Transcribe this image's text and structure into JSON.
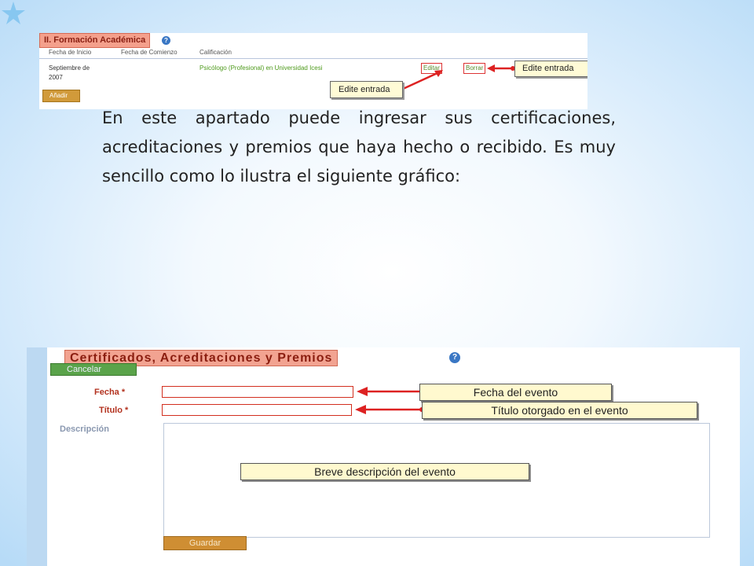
{
  "top_screenshot": {
    "section_title": "II. Formación Académica",
    "help_icon": "question-icon",
    "columns": [
      "Fecha de Inicio",
      "Fecha de Comienzo",
      "Calificación"
    ],
    "row": {
      "date_line1": "Septiembre de",
      "date_line2": "2007",
      "qualification": "Psicólogo (Profesional) en Universidad Icesi",
      "edit_link": "Editar",
      "delete_link": "Borrar"
    },
    "add_button": "Añadir",
    "callout_edit_right": "Edite entrada",
    "callout_edit_bottom": "Edite entrada",
    "accent_color": "#d33a2a"
  },
  "intro_text": "En este apartado puede ingresar sus certificaciones, acreditaciones y premios que haya hecho o recibido. Es muy sencillo como lo ilustra el siguiente gráfico:",
  "bottom_screenshot": {
    "section_title": "Certificados, Acreditaciones y Premios",
    "help_icon": "question-icon",
    "cancel_button": "Cancelar",
    "fields": {
      "date_label": "Fecha *",
      "title_label": "Título *",
      "description_label": "Descripción"
    },
    "save_button": "Guardar",
    "callouts": {
      "date": "Fecha del evento",
      "title": "Título otorgado en el evento",
      "description": "Breve descripción del evento"
    }
  },
  "decoration": {
    "bullet_icon": "star-bullet-icon",
    "background_color": "#b7dbf7"
  }
}
